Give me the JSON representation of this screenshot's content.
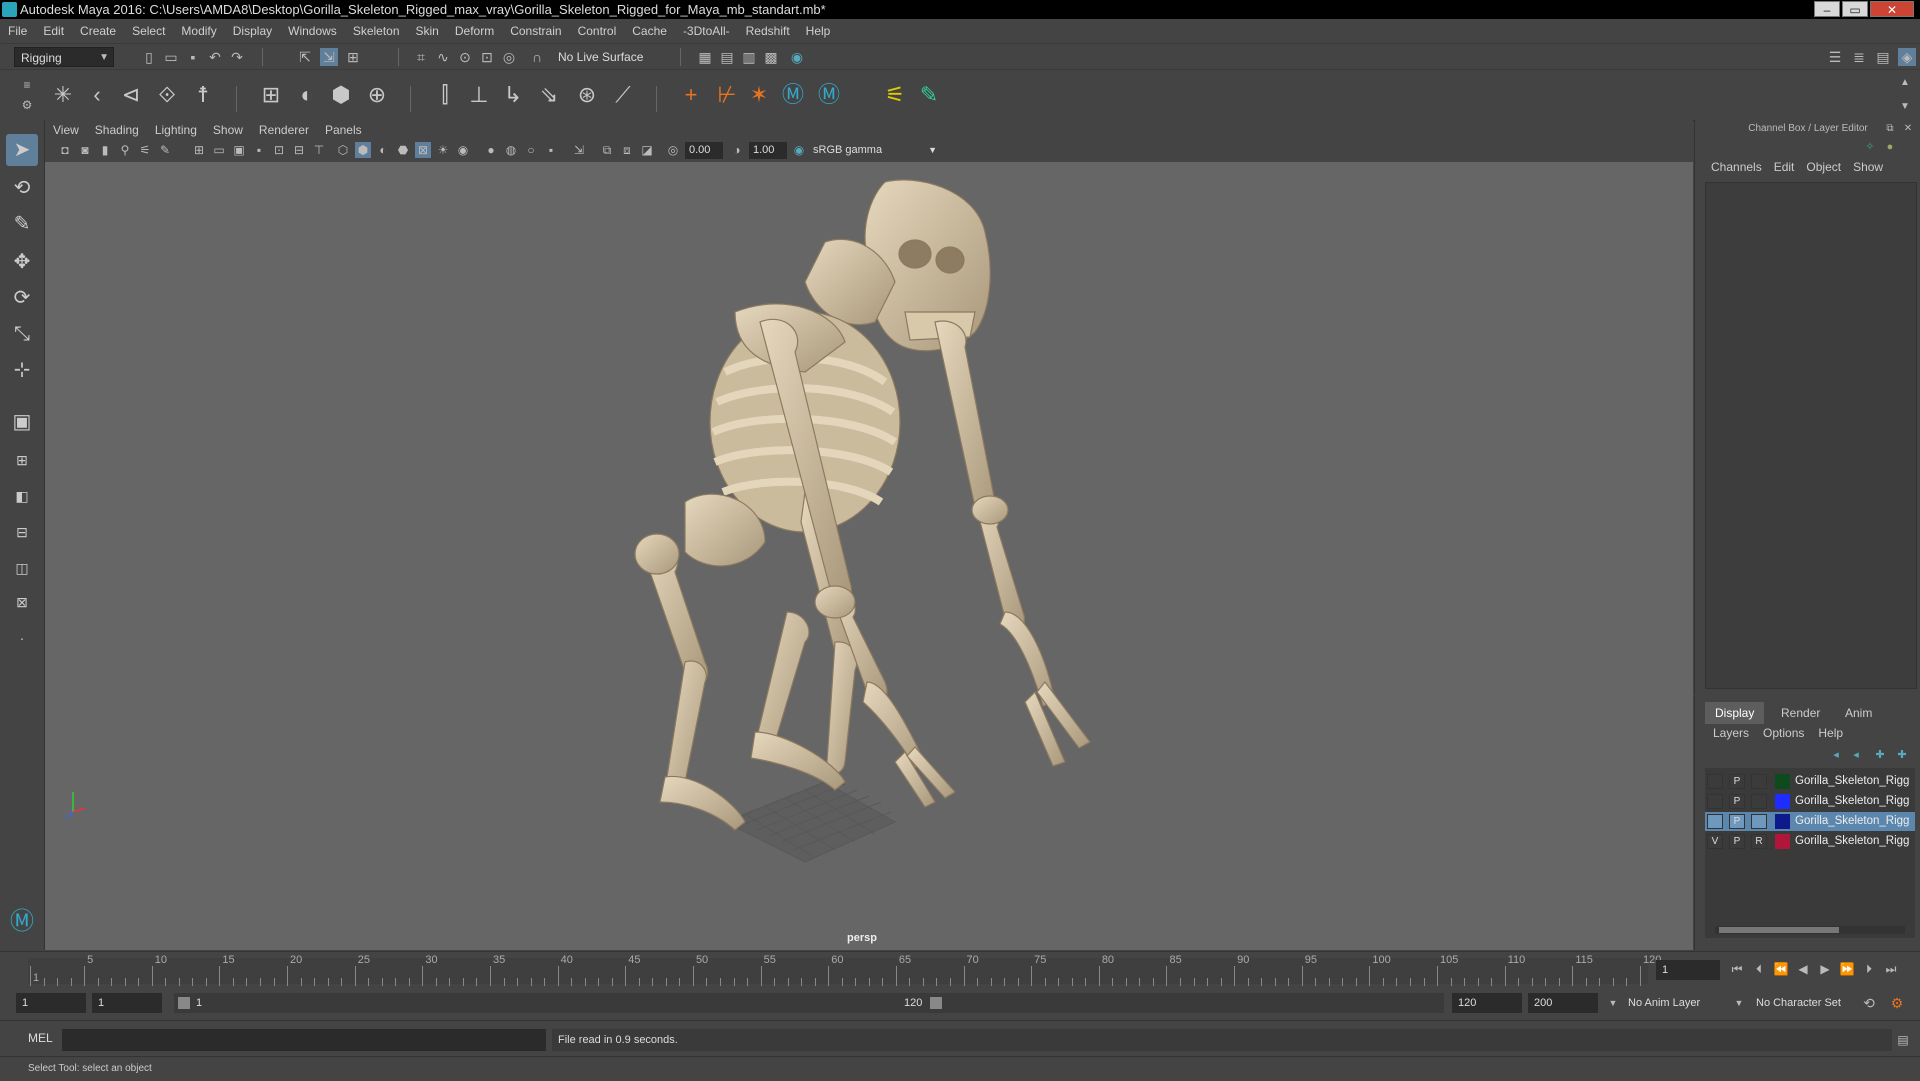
{
  "window": {
    "title": "Autodesk Maya 2016: C:\\Users\\AMDA8\\Desktop\\Gorilla_Skeleton_Rigged_max_vray\\Gorilla_Skeleton_Rigged_for_Maya_mb_standart.mb*",
    "minimize": "–",
    "maximize": "▭",
    "close": "✕"
  },
  "menubar": [
    "File",
    "Edit",
    "Create",
    "Select",
    "Modify",
    "Display",
    "Windows",
    "Skeleton",
    "Skin",
    "Deform",
    "Constrain",
    "Control",
    "Cache",
    "-3DtoAll-",
    "Redshift",
    "Help"
  ],
  "statusline": {
    "mode": "Rigging",
    "live_surface": "No Live Surface"
  },
  "viewport": {
    "menu": [
      "View",
      "Shading",
      "Lighting",
      "Show",
      "Renderer",
      "Panels"
    ],
    "exposure": "0.00",
    "gamma": "1.00",
    "colorspace": "sRGB gamma",
    "camera": "persp"
  },
  "channelbox": {
    "header": "Channel Box / Layer Editor",
    "tabs": [
      "Channels",
      "Edit",
      "Object",
      "Show"
    ]
  },
  "layereditor": {
    "tabs": [
      "Display",
      "Render",
      "Anim"
    ],
    "active_tab": "Display",
    "menu": [
      "Layers",
      "Options",
      "Help"
    ],
    "layers": [
      {
        "v": "",
        "p": "P",
        "r": "",
        "color": "#0d4a1e",
        "name": "Gorilla_Skeleton_Rigg",
        "selected": false
      },
      {
        "v": "",
        "p": "P",
        "r": "",
        "color": "#1f2cff",
        "name": "Gorilla_Skeleton_Rigg",
        "selected": false
      },
      {
        "v": "",
        "p": "P",
        "r": "",
        "color": "#0c1a8c",
        "name": "Gorilla_Skeleton_Rigg",
        "selected": true
      },
      {
        "v": "V",
        "p": "P",
        "r": "R",
        "color": "#b0163a",
        "name": "Gorilla_Skeleton_Rigg",
        "selected": false
      }
    ]
  },
  "timeline": {
    "ticks": [
      "1",
      "5",
      "10",
      "15",
      "20",
      "25",
      "30",
      "35",
      "40",
      "45",
      "50",
      "55",
      "60",
      "65",
      "70",
      "75",
      "80",
      "85",
      "90",
      "95",
      "100",
      "105",
      "110",
      "115",
      "120"
    ],
    "current_frame": "1"
  },
  "range": {
    "start": "1",
    "playback_start": "1",
    "slider_start": "1",
    "slider_end": "120",
    "playback_end": "120",
    "end": "200",
    "anim_layer": "No Anim Layer",
    "character_set": "No Character Set"
  },
  "commandline": {
    "language": "MEL",
    "result": "File read in  0.9 seconds."
  },
  "helpline": {
    "text": "Select Tool: select an object"
  }
}
